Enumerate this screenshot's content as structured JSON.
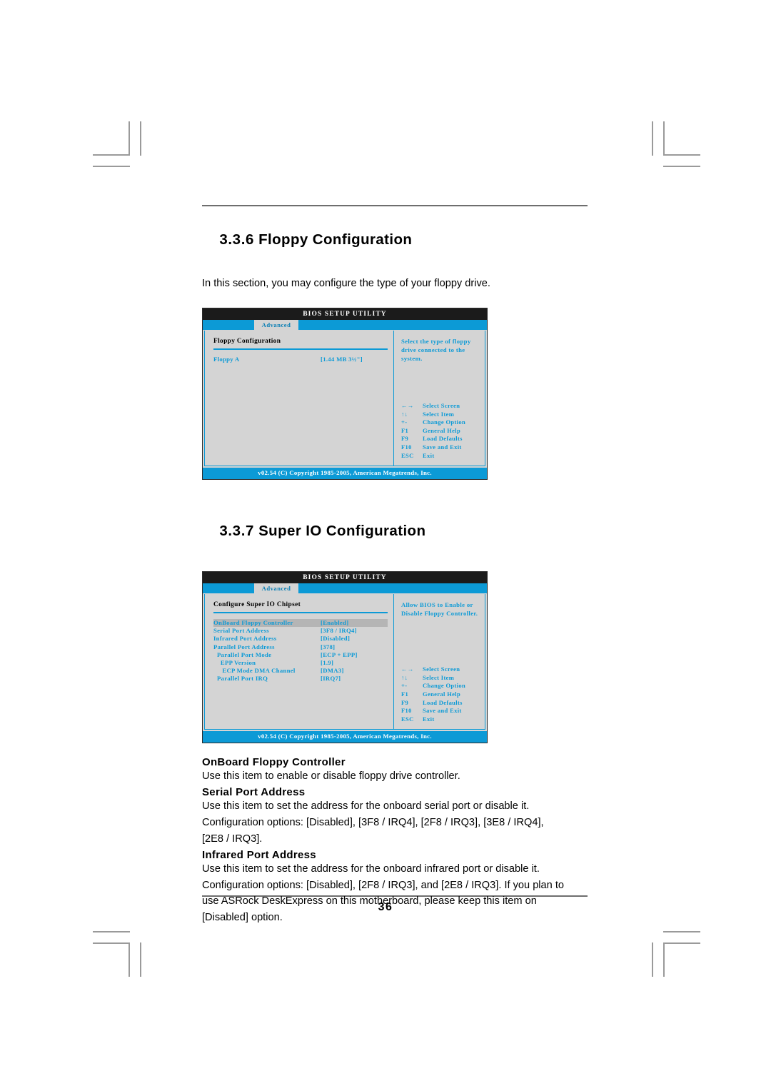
{
  "page": {
    "number": "36"
  },
  "sections": [
    {
      "id": "floppy-configuration",
      "number": "3.3.6",
      "title": "Floppy Configuration",
      "intro": "In this section, you may configure the type of your floppy drive."
    },
    {
      "id": "super-io-configuration",
      "number": "3.3.7",
      "title": "Super IO Configuration"
    }
  ],
  "bios_common": {
    "title": "BIOS SETUP UTILITY",
    "tab": "Advanced",
    "footer": "v02.54 (C) Copyright 1985-2005, American Megatrends, Inc.",
    "legend": [
      {
        "keys": "←→",
        "action": "Select Screen"
      },
      {
        "keys": "↑↓",
        "action": "Select Item"
      },
      {
        "keys": "+-",
        "action": "Change Option"
      },
      {
        "keys": "F1",
        "action": "General Help"
      },
      {
        "keys": "F9",
        "action": "Load Defaults"
      },
      {
        "keys": "F10",
        "action": "Save and Exit"
      },
      {
        "keys": "ESC",
        "action": "Exit"
      }
    ]
  },
  "bios_floppy": {
    "group_title": "Floppy Configuration",
    "rows": [
      {
        "label": "Floppy A",
        "value": "[1.44 MB 3½\"]",
        "selected": false
      }
    ],
    "help": "Select the type of floppy drive connected to the system."
  },
  "bios_superio": {
    "group_title": "Configure Super IO Chipset",
    "rows": [
      {
        "label": "OnBoard Floppy Controller",
        "value": "[Enabled]",
        "selected": true
      },
      {
        "label": "Serial Port Address",
        "value": "[3F8 / IRQ4]",
        "selected": false
      },
      {
        "label": "Infrared Port Address",
        "value": "[Disabled]",
        "selected": false
      },
      {
        "label": "Parallel Port Address",
        "value": "[378]",
        "selected": false
      },
      {
        "label": "  Parallel Port Mode",
        "value": "[ECP + EPP]",
        "selected": false
      },
      {
        "label": "    EPP Version",
        "value": "[1.9]",
        "selected": false
      },
      {
        "label": "     ECP Mode DMA Channel",
        "value": "[DMA3]",
        "selected": false
      },
      {
        "label": "  Parallel Port IRQ",
        "value": "[IRQ7]",
        "selected": false
      }
    ],
    "help": "Allow BIOS to Enable or Disable Floppy Controller."
  },
  "descriptions": [
    {
      "term": "OnBoard Floppy Controller",
      "lines": [
        "Use this item to enable or disable floppy drive controller."
      ]
    },
    {
      "term": "Serial Port Address",
      "lines": [
        "Use this item to set the address for the onboard serial port or disable it.",
        "Configuration options: [Disabled], [3F8 / IRQ4], [2F8 / IRQ3], [3E8 / IRQ4],",
        "[2E8 / IRQ3]."
      ]
    },
    {
      "term": "Infrared Port Address",
      "lines": [
        "Use this item to set the address for the onboard infrared port or disable it.",
        "Configuration options: [Disabled], [2F8 / IRQ3], and [2E8 / IRQ3]. If you plan to",
        "use ASRock DeskExpress on this motherboard, please keep this item on",
        "[Disabled] option."
      ]
    }
  ],
  "colors": {
    "bios_blue": "#0c9ad6",
    "bios_panel": "#d4d4d4",
    "bios_titlebar": "#1b1b1b",
    "crop_mark": "#9a9a9a"
  }
}
